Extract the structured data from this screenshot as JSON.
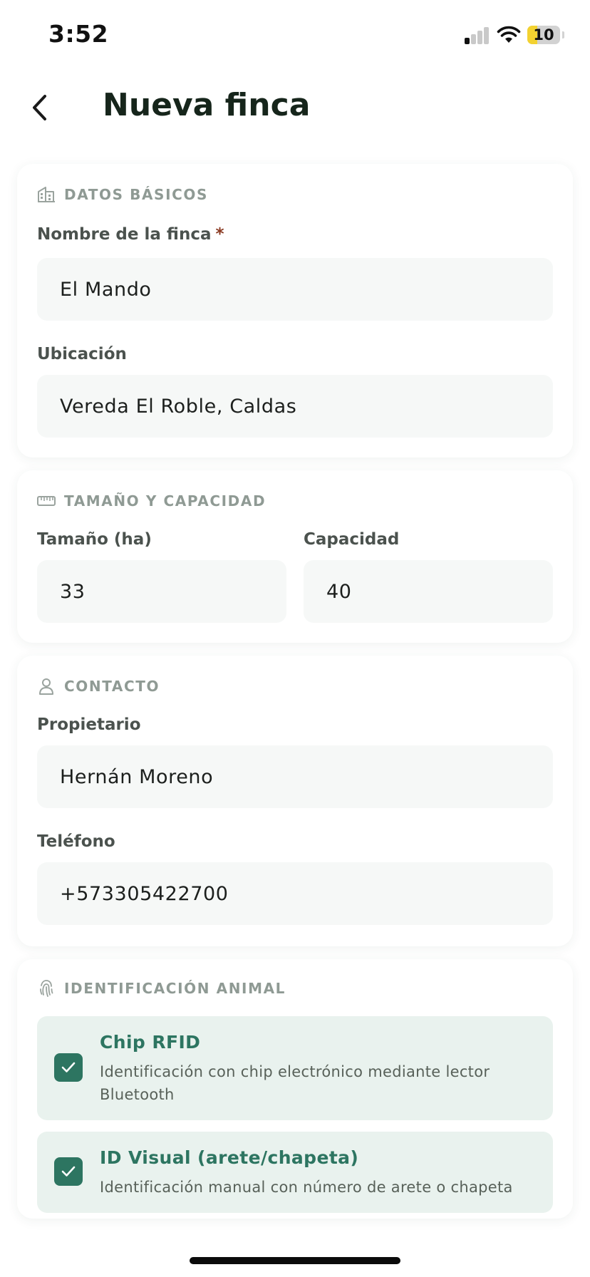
{
  "status_bar": {
    "time": "3:52",
    "battery": "10"
  },
  "header": {
    "title": "Nueva finca"
  },
  "basic": {
    "title": "DATOS BÁSICOS",
    "name_label": "Nombre de la finca",
    "required_mark": "*",
    "name_value": "El Mando",
    "location_label": "Ubicación",
    "location_value": "Vereda El Roble, Caldas"
  },
  "size": {
    "title": "TAMAÑO Y CAPACIDAD",
    "size_label": "Tamaño (ha)",
    "size_value": "33",
    "capacity_label": "Capacidad",
    "capacity_value": "40"
  },
  "contact": {
    "title": "CONTACTO",
    "owner_label": "Propietario",
    "owner_value": "Hernán Moreno",
    "phone_label": "Teléfono",
    "phone_value": "+573305422700"
  },
  "identification": {
    "title": "IDENTIFICACIÓN ANIMAL",
    "options": [
      {
        "title": "Chip RFID",
        "description": "Identificación con chip electrónico mediante lector Bluetooth",
        "checked": true
      },
      {
        "title": "ID Visual (arete/chapeta)",
        "description": "Identificación manual con número de arete o chapeta",
        "checked": true
      }
    ]
  },
  "colors": {
    "accent": "#2d7561",
    "option_bg": "#e9f2ee",
    "input_bg": "#f6f8f7",
    "required": "#8a3a22",
    "section_title": "#8f9a94"
  },
  "icons": {
    "back": "chevron-left-icon",
    "basic": "building-icon",
    "size": "ruler-icon",
    "contact": "person-icon",
    "identification": "fingerprint-icon",
    "check": "check-icon"
  }
}
